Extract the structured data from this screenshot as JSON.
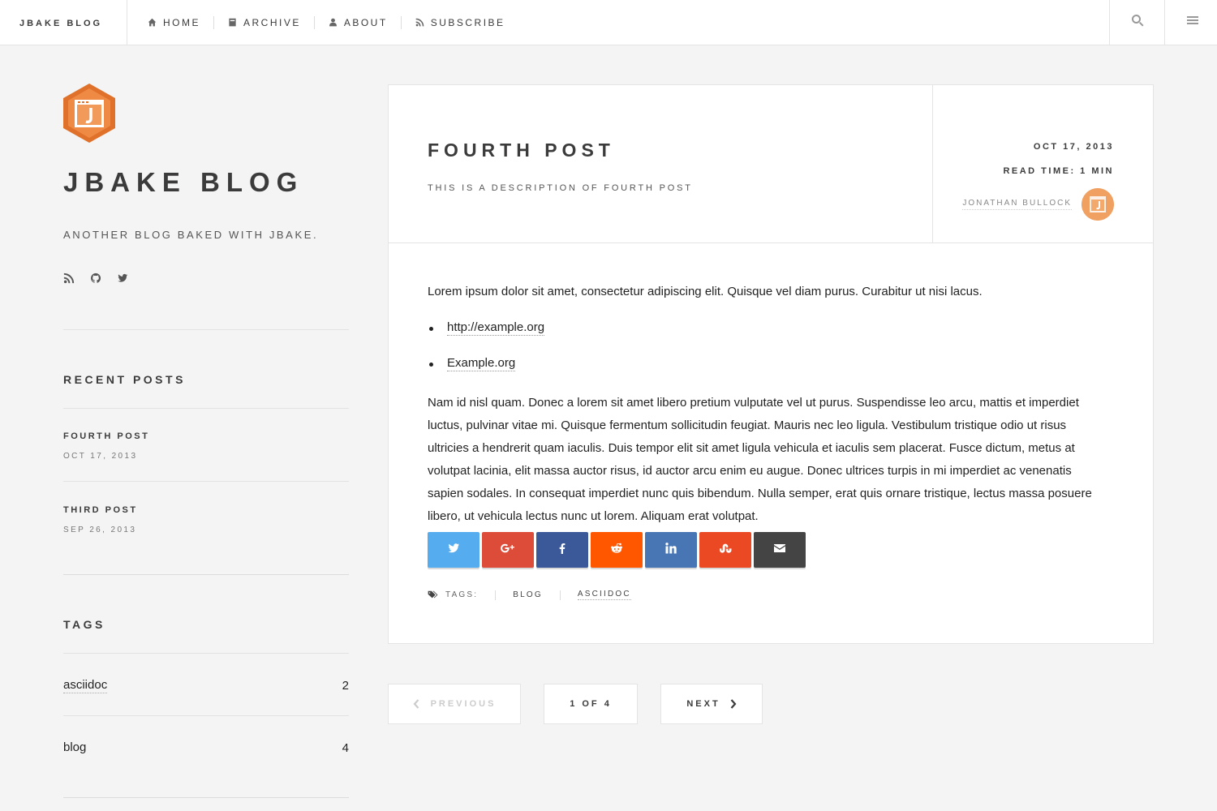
{
  "header": {
    "brand": "JBAKE BLOG",
    "nav": [
      {
        "label": "HOME",
        "icon": "home-icon"
      },
      {
        "label": "ARCHIVE",
        "icon": "archive-icon"
      },
      {
        "label": "ABOUT",
        "icon": "user-icon"
      },
      {
        "label": "SUBSCRIBE",
        "icon": "rss-icon"
      }
    ]
  },
  "sidebar": {
    "title": "JBAKE BLOG",
    "subtitle": "ANOTHER BLOG BAKED WITH JBAKE.",
    "social_icons": [
      "rss-icon",
      "github-icon",
      "twitter-icon"
    ],
    "recent_title": "RECENT POSTS",
    "recent": [
      {
        "title": "FOURTH POST",
        "date": "OCT 17, 2013"
      },
      {
        "title": "THIRD POST",
        "date": "SEP 26, 2013"
      }
    ],
    "tags_title": "TAGS",
    "tags": [
      {
        "name": "asciidoc",
        "count": "2"
      },
      {
        "name": "blog",
        "count": "4"
      }
    ]
  },
  "post": {
    "title": "FOURTH POST",
    "description": "THIS IS A DESCRIPTION OF FOURTH POST",
    "date": "OCT 17, 2013",
    "read_time": "READ TIME: 1 MIN",
    "author": "JONATHAN BULLOCK",
    "p1": "Lorem ipsum dolor sit amet, consectetur adipiscing elit. Quisque vel diam purus. Curabitur ut nisi lacus.",
    "links": [
      "http://example.org",
      "Example.org"
    ],
    "p2": "Nam id nisl quam. Donec a lorem sit amet libero pretium vulputate vel ut purus. Suspendisse leo arcu, mattis et imperdiet luctus, pulvinar vitae mi. Quisque fermentum sollicitudin feugiat. Mauris nec leo ligula. Vestibulum tristique odio ut risus ultricies a hendrerit quam iaculis. Duis tempor elit sit amet ligula vehicula et iaculis sem placerat. Fusce dictum, metus at volutpat lacinia, elit massa auctor risus, id auctor arcu enim eu augue. Donec ultrices turpis in mi imperdiet ac venenatis sapien sodales. In consequat imperdiet nunc quis bibendum. Nulla semper, erat quis ornare tristique, lectus massa posuere libero, ut vehicula lectus nunc ut lorem. Aliquam erat volutpat.",
    "share": [
      {
        "name": "twitter",
        "color": "#55acee"
      },
      {
        "name": "google-plus",
        "color": "#dd4b39"
      },
      {
        "name": "facebook",
        "color": "#3b5998"
      },
      {
        "name": "reddit",
        "color": "#ff5700"
      },
      {
        "name": "linkedin",
        "color": "#4875b4"
      },
      {
        "name": "stumbleupon",
        "color": "#eb4924"
      },
      {
        "name": "email",
        "color": "#444444"
      }
    ],
    "tags_label": "TAGS:",
    "tags": [
      "BLOG",
      "ASCIIDOC"
    ]
  },
  "pagination": {
    "previous": "PREVIOUS",
    "count": "1 OF 4",
    "next": "NEXT"
  }
}
